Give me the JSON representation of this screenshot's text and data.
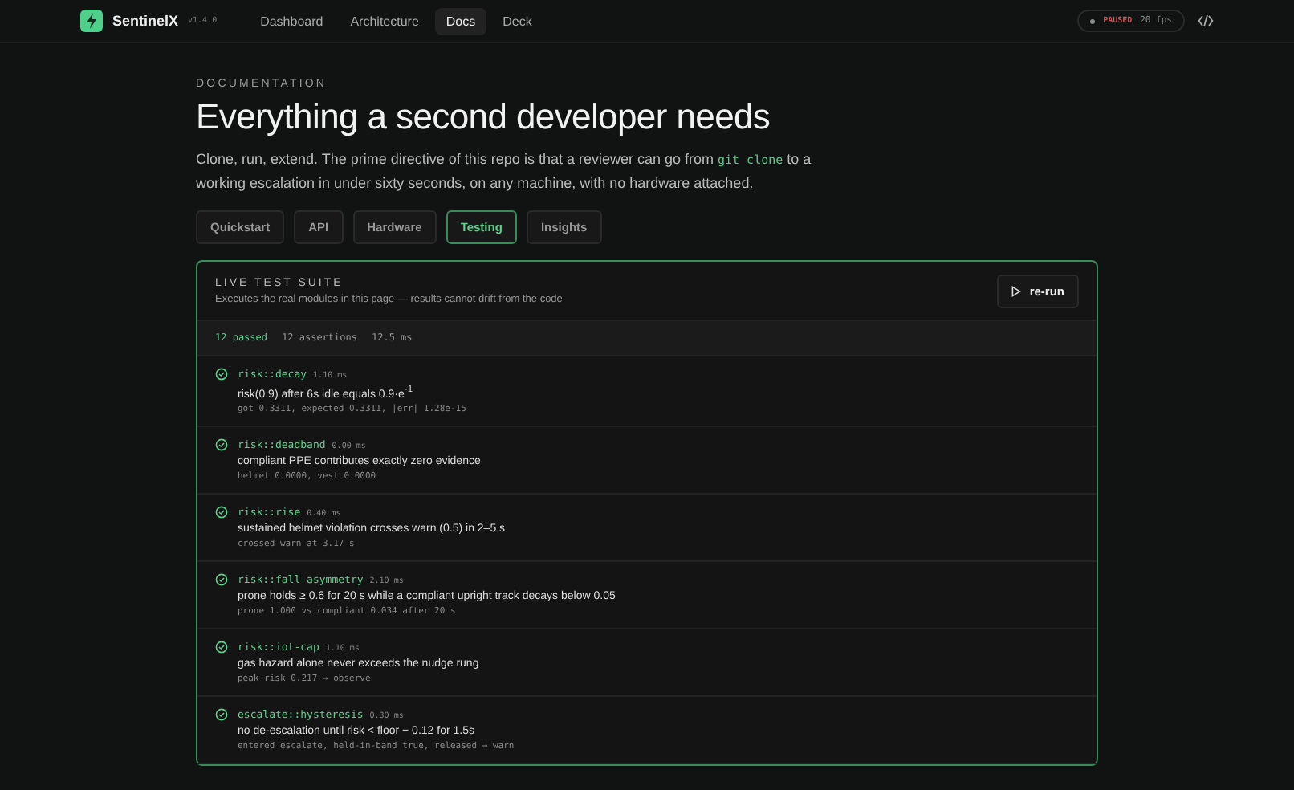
{
  "nav": {
    "brand": "SentinelX",
    "version": "v1.4.0",
    "items": [
      {
        "label": "Dashboard",
        "selected": false
      },
      {
        "label": "Architecture",
        "selected": false
      },
      {
        "label": "Docs",
        "selected": true
      },
      {
        "label": "Deck",
        "selected": false
      }
    ],
    "status": {
      "label": "PAUSED",
      "fps": "20 fps"
    }
  },
  "header": {
    "eyebrow": "DOCUMENTATION",
    "title": "Everything a second developer needs",
    "intro_before": "Clone, run, extend. The prime directive of this repo is that a reviewer can go from ",
    "intro_code": "git clone",
    "intro_after": " to a working escalation in under sixty seconds, on any machine, with no hardware attached."
  },
  "tabs": [
    {
      "label": "Quickstart",
      "selected": false
    },
    {
      "label": "API",
      "selected": false
    },
    {
      "label": "Hardware",
      "selected": false
    },
    {
      "label": "Testing",
      "selected": true
    },
    {
      "label": "Insights",
      "selected": false
    }
  ],
  "suite": {
    "title": "LIVE TEST SUITE",
    "subtitle": "Executes the real modules in this page — results cannot drift from the code",
    "button": "re-run",
    "summary": {
      "passed": "12 passed",
      "assertions": "12 assertions",
      "time": "12.5 ms"
    },
    "tests": [
      {
        "name": "risk::decay",
        "time": "1.10 ms",
        "passed": true,
        "description": "risk(0.9) after 6s idle equals 0.9·e$^{-1}$",
        "detail": "got 0.3311, expected 0.3311, |err| 1.28e-15"
      },
      {
        "name": "risk::deadband",
        "time": "0.00 ms",
        "passed": true,
        "description": "compliant PPE contributes exactly zero evidence",
        "detail": "helmet 0.0000, vest 0.0000"
      },
      {
        "name": "risk::rise",
        "time": "0.40 ms",
        "passed": true,
        "description": "sustained helmet violation crosses warn (0.5) in 2–5 s",
        "detail": "crossed warn at 3.17 s"
      },
      {
        "name": "risk::fall-asymmetry",
        "time": "2.10 ms",
        "passed": true,
        "description": "prone holds ≥ 0.6 for 20 s while a compliant upright track decays below 0.05",
        "detail": "prone 1.000 vs compliant 0.034 after 20 s"
      },
      {
        "name": "risk::iot-cap",
        "time": "1.10 ms",
        "passed": true,
        "description": "gas hazard alone never exceeds the nudge rung",
        "detail": "peak risk 0.217 → observe"
      },
      {
        "name": "escalate::hysteresis",
        "time": "0.30 ms",
        "passed": true,
        "description": "no de-escalation until risk < floor − 0.12 for 1.5s",
        "detail": "entered escalate, held-in-band true, released → warn"
      }
    ]
  }
}
